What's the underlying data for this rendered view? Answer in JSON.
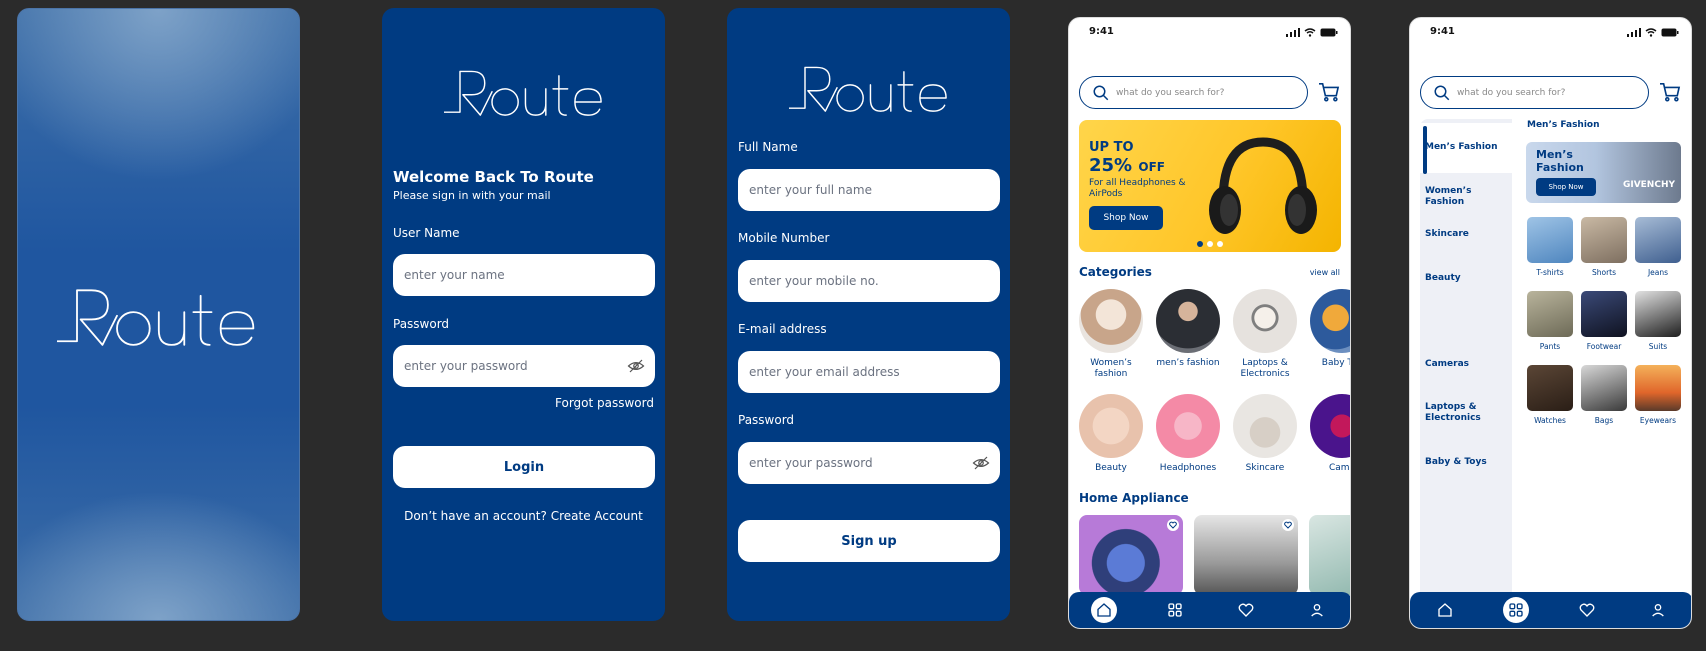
{
  "brand": {
    "logo_text": "Route",
    "primary": "#003b82"
  },
  "login": {
    "title": "Welcome Back To Route",
    "subtitle": "Please sign in with your mail",
    "username_label": "User Name",
    "username_placeholder": "enter your name",
    "password_label": "Password",
    "password_placeholder": "enter your password",
    "forgot": "Forgot password",
    "login_button": "Login",
    "create_account": "Don’t have an account? Create Account"
  },
  "signup": {
    "fullname_label": "Full Name",
    "fullname_placeholder": "enter your full name",
    "mobile_label": "Mobile Number",
    "mobile_placeholder": "enter your mobile no.",
    "email_label": "E-mail address",
    "email_placeholder": "enter your email address",
    "password_label": "Password",
    "password_placeholder": "enter your password",
    "signup_button": "Sign up"
  },
  "home": {
    "time": "9:41",
    "search_placeholder": "what do you search for?",
    "banner": {
      "line1": "UP TO",
      "percent": "25%",
      "off": "OFF",
      "desc": "For all Headphones & AirPods",
      "button": "Shop Now"
    },
    "categories_title": "Categories",
    "view_all": "view all",
    "categories": [
      {
        "label": "Women’s fashion"
      },
      {
        "label": "men’s fashion"
      },
      {
        "label": "Laptops & Electronics"
      },
      {
        "label": "Baby Toy"
      },
      {
        "label": "Beauty"
      },
      {
        "label": "Headphones"
      },
      {
        "label": "Skincare"
      },
      {
        "label": "Came"
      }
    ],
    "home_appliance_title": "Home Appliance"
  },
  "catalog": {
    "time": "9:41",
    "search_placeholder": "what do you search for?",
    "sidebar": [
      "Men’s Fashion",
      "Women’s Fashion",
      "Skincare",
      "Beauty",
      "Cameras",
      "Laptops & Electronics",
      "Baby & Toys"
    ],
    "section_title": "Men’s Fashion",
    "banner_title": "Men’s Fashion",
    "banner_button": "Shop Now",
    "banner_brand": "GIVENCHY",
    "tiles": [
      "T-shirts",
      "Shorts",
      "Jeans",
      "Pants",
      "Footwear",
      "Suits",
      "Watches",
      "Bags",
      "Eyewears"
    ]
  },
  "nav": [
    "home-icon",
    "categories-icon",
    "wishlist-icon",
    "profile-icon"
  ]
}
